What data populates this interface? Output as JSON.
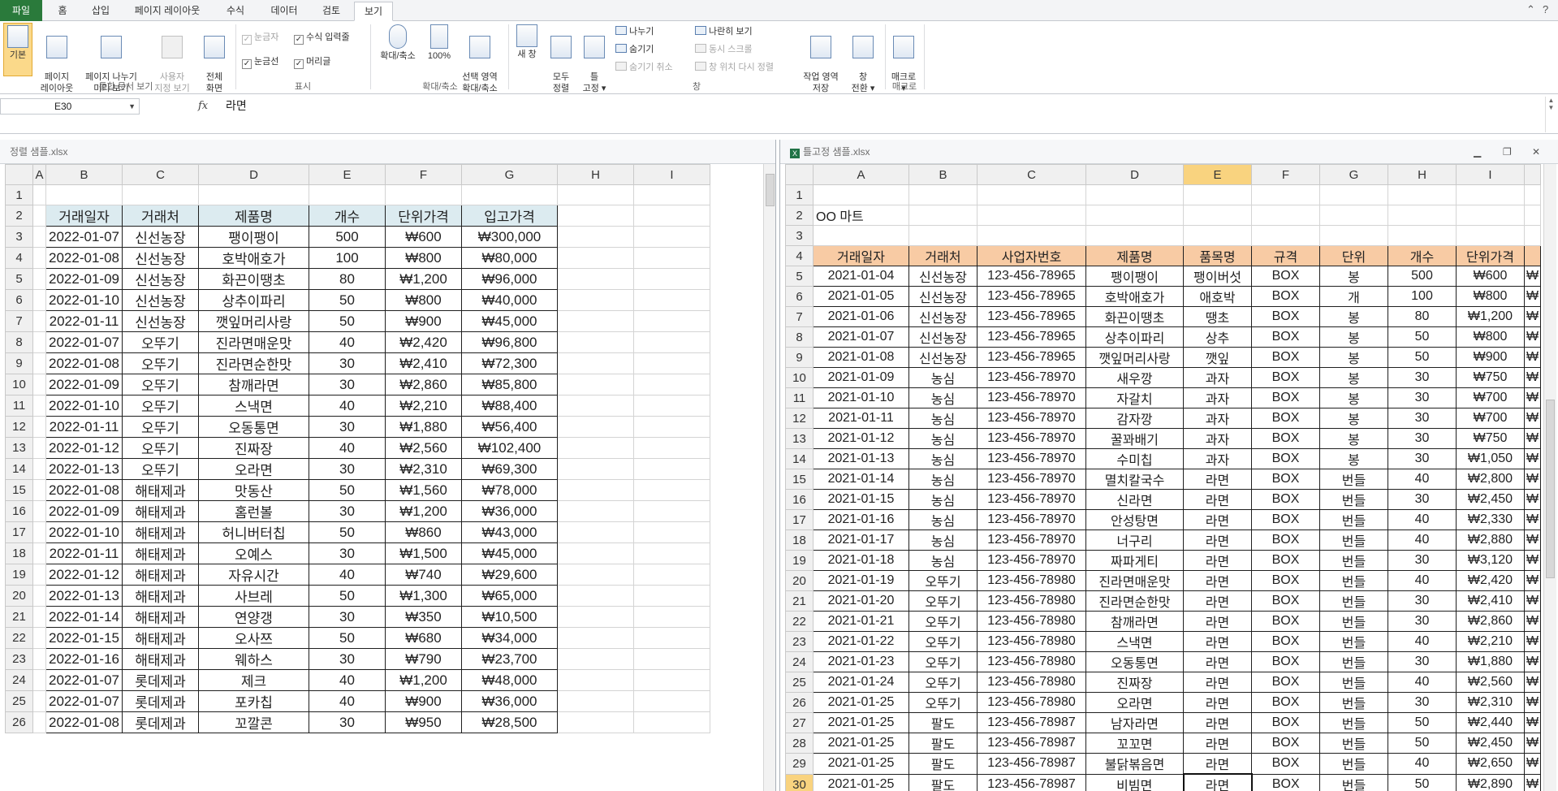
{
  "tabs": [
    "파일",
    "홈",
    "삽입",
    "페이지 레이아웃",
    "수식",
    "데이터",
    "검토",
    "보기"
  ],
  "ribbon": {
    "views": [
      "기본",
      "페이지\n레이아웃",
      "페이지 나누기\n미리 보기",
      "사용자\n지정 보기",
      "전체\n화면"
    ],
    "group_views": "통합 문서 보기",
    "show": [
      "눈금자",
      "수식 입력줄",
      "눈금선",
      "머리글"
    ],
    "group_show": "표시",
    "zoom": [
      "확대/축소",
      "100%",
      "선택 영역\n확대/축소"
    ],
    "group_zoom": "확대/축소",
    "window_big": [
      "새 창",
      "모두\n정렬",
      "틀\n고정 ▾"
    ],
    "window_small": [
      "나누기",
      "숨기기",
      "숨기기 취소",
      "나란히 보기",
      "동시 스크롤",
      "창 위치 다시 정렬"
    ],
    "window_big2": [
      "작업 영역\n저장",
      "창\n전환 ▾"
    ],
    "group_window": "창",
    "macro": "매크로\n▾",
    "group_macro": "매크로"
  },
  "formula": {
    "cell": "E30",
    "fx": "fx",
    "value": "라면"
  },
  "left": {
    "title": "정렬 샘플.xlsx",
    "cols": [
      "A",
      "B",
      "C",
      "D",
      "E",
      "F",
      "G",
      "H",
      "I"
    ],
    "headers": [
      "거래일자",
      "거래처",
      "제품명",
      "개수",
      "단위가격",
      "입고가격"
    ],
    "rows": [
      [
        "2022-01-07",
        "신선농장",
        "팽이팽이",
        "500",
        "₩600",
        "₩300,000"
      ],
      [
        "2022-01-08",
        "신선농장",
        "호박애호가",
        "100",
        "₩800",
        "₩80,000"
      ],
      [
        "2022-01-09",
        "신선농장",
        "화끈이땡초",
        "80",
        "₩1,200",
        "₩96,000"
      ],
      [
        "2022-01-10",
        "신선농장",
        "상추이파리",
        "50",
        "₩800",
        "₩40,000"
      ],
      [
        "2022-01-11",
        "신선농장",
        "깻잎머리사랑",
        "50",
        "₩900",
        "₩45,000"
      ],
      [
        "2022-01-07",
        "오뚜기",
        "진라면매운맛",
        "40",
        "₩2,420",
        "₩96,800"
      ],
      [
        "2022-01-08",
        "오뚜기",
        "진라면순한맛",
        "30",
        "₩2,410",
        "₩72,300"
      ],
      [
        "2022-01-09",
        "오뚜기",
        "참깨라면",
        "30",
        "₩2,860",
        "₩85,800"
      ],
      [
        "2022-01-10",
        "오뚜기",
        "스낵면",
        "40",
        "₩2,210",
        "₩88,400"
      ],
      [
        "2022-01-11",
        "오뚜기",
        "오동통면",
        "30",
        "₩1,880",
        "₩56,400"
      ],
      [
        "2022-01-12",
        "오뚜기",
        "진짜장",
        "40",
        "₩2,560",
        "₩102,400"
      ],
      [
        "2022-01-13",
        "오뚜기",
        "오라면",
        "30",
        "₩2,310",
        "₩69,300"
      ],
      [
        "2022-01-08",
        "해태제과",
        "맛동산",
        "50",
        "₩1,560",
        "₩78,000"
      ],
      [
        "2022-01-09",
        "해태제과",
        "홈런볼",
        "30",
        "₩1,200",
        "₩36,000"
      ],
      [
        "2022-01-10",
        "해태제과",
        "허니버터칩",
        "50",
        "₩860",
        "₩43,000"
      ],
      [
        "2022-01-11",
        "해태제과",
        "오예스",
        "30",
        "₩1,500",
        "₩45,000"
      ],
      [
        "2022-01-12",
        "해태제과",
        "자유시간",
        "40",
        "₩740",
        "₩29,600"
      ],
      [
        "2022-01-13",
        "해태제과",
        "사브레",
        "50",
        "₩1,300",
        "₩65,000"
      ],
      [
        "2022-01-14",
        "해태제과",
        "연양갱",
        "30",
        "₩350",
        "₩10,500"
      ],
      [
        "2022-01-15",
        "해태제과",
        "오사쯔",
        "50",
        "₩680",
        "₩34,000"
      ],
      [
        "2022-01-16",
        "해태제과",
        "웨하스",
        "30",
        "₩790",
        "₩23,700"
      ],
      [
        "2022-01-07",
        "롯데제과",
        "제크",
        "40",
        "₩1,200",
        "₩48,000"
      ],
      [
        "2022-01-07",
        "롯데제과",
        "포카칩",
        "40",
        "₩900",
        "₩36,000"
      ],
      [
        "2022-01-08",
        "롯데제과",
        "꼬깔콘",
        "30",
        "₩950",
        "₩28,500"
      ]
    ]
  },
  "right": {
    "title": "틀고정 샘플.xlsx",
    "cols": [
      "A",
      "B",
      "C",
      "D",
      "E",
      "F",
      "G",
      "H",
      "I",
      ""
    ],
    "store": "OO 마트",
    "headers": [
      "거래일자",
      "거래처",
      "사업자번호",
      "제품명",
      "품목명",
      "규격",
      "단위",
      "개수",
      "단위가격",
      ""
    ],
    "rows": [
      [
        "2021-01-04",
        "신선농장",
        "123-456-78965",
        "팽이팽이",
        "팽이버섯",
        "BOX",
        "봉",
        "500",
        "₩600",
        "₩"
      ],
      [
        "2021-01-05",
        "신선농장",
        "123-456-78965",
        "호박애호가",
        "애호박",
        "BOX",
        "개",
        "100",
        "₩800",
        "₩"
      ],
      [
        "2021-01-06",
        "신선농장",
        "123-456-78965",
        "화끈이땡초",
        "땡초",
        "BOX",
        "봉",
        "80",
        "₩1,200",
        "₩"
      ],
      [
        "2021-01-07",
        "신선농장",
        "123-456-78965",
        "상추이파리",
        "상추",
        "BOX",
        "봉",
        "50",
        "₩800",
        "₩"
      ],
      [
        "2021-01-08",
        "신선농장",
        "123-456-78965",
        "깻잎머리사랑",
        "깻잎",
        "BOX",
        "봉",
        "50",
        "₩900",
        "₩"
      ],
      [
        "2021-01-09",
        "농심",
        "123-456-78970",
        "새우깡",
        "과자",
        "BOX",
        "봉",
        "30",
        "₩750",
        "₩"
      ],
      [
        "2021-01-10",
        "농심",
        "123-456-78970",
        "자갈치",
        "과자",
        "BOX",
        "봉",
        "30",
        "₩700",
        "₩"
      ],
      [
        "2021-01-11",
        "농심",
        "123-456-78970",
        "감자깡",
        "과자",
        "BOX",
        "봉",
        "30",
        "₩700",
        "₩"
      ],
      [
        "2021-01-12",
        "농심",
        "123-456-78970",
        "꿀꽈배기",
        "과자",
        "BOX",
        "봉",
        "30",
        "₩750",
        "₩"
      ],
      [
        "2021-01-13",
        "농심",
        "123-456-78970",
        "수미칩",
        "과자",
        "BOX",
        "봉",
        "30",
        "₩1,050",
        "₩"
      ],
      [
        "2021-01-14",
        "농심",
        "123-456-78970",
        "멸치칼국수",
        "라면",
        "BOX",
        "번들",
        "40",
        "₩2,800",
        "₩"
      ],
      [
        "2021-01-15",
        "농심",
        "123-456-78970",
        "신라면",
        "라면",
        "BOX",
        "번들",
        "30",
        "₩2,450",
        "₩"
      ],
      [
        "2021-01-16",
        "농심",
        "123-456-78970",
        "안성탕면",
        "라면",
        "BOX",
        "번들",
        "40",
        "₩2,330",
        "₩"
      ],
      [
        "2021-01-17",
        "농심",
        "123-456-78970",
        "너구리",
        "라면",
        "BOX",
        "번들",
        "40",
        "₩2,880",
        "₩"
      ],
      [
        "2021-01-18",
        "농심",
        "123-456-78970",
        "짜파게티",
        "라면",
        "BOX",
        "번들",
        "30",
        "₩3,120",
        "₩"
      ],
      [
        "2021-01-19",
        "오뚜기",
        "123-456-78980",
        "진라면매운맛",
        "라면",
        "BOX",
        "번들",
        "40",
        "₩2,420",
        "₩"
      ],
      [
        "2021-01-20",
        "오뚜기",
        "123-456-78980",
        "진라면순한맛",
        "라면",
        "BOX",
        "번들",
        "30",
        "₩2,410",
        "₩"
      ],
      [
        "2021-01-21",
        "오뚜기",
        "123-456-78980",
        "참깨라면",
        "라면",
        "BOX",
        "번들",
        "30",
        "₩2,860",
        "₩"
      ],
      [
        "2021-01-22",
        "오뚜기",
        "123-456-78980",
        "스낵면",
        "라면",
        "BOX",
        "번들",
        "40",
        "₩2,210",
        "₩"
      ],
      [
        "2021-01-23",
        "오뚜기",
        "123-456-78980",
        "오동통면",
        "라면",
        "BOX",
        "번들",
        "30",
        "₩1,880",
        "₩"
      ],
      [
        "2021-01-24",
        "오뚜기",
        "123-456-78980",
        "진짜장",
        "라면",
        "BOX",
        "번들",
        "40",
        "₩2,560",
        "₩"
      ],
      [
        "2021-01-25",
        "오뚜기",
        "123-456-78980",
        "오라면",
        "라면",
        "BOX",
        "번들",
        "30",
        "₩2,310",
        "₩"
      ],
      [
        "2021-01-25",
        "팔도",
        "123-456-78987",
        "남자라면",
        "라면",
        "BOX",
        "번들",
        "50",
        "₩2,440",
        "₩"
      ],
      [
        "2021-01-25",
        "팔도",
        "123-456-78987",
        "꼬꼬면",
        "라면",
        "BOX",
        "번들",
        "50",
        "₩2,450",
        "₩"
      ],
      [
        "2021-01-25",
        "팔도",
        "123-456-78987",
        "불닭볶음면",
        "라면",
        "BOX",
        "번들",
        "40",
        "₩2,650",
        "₩"
      ],
      [
        "2021-01-25",
        "팔도",
        "123-456-78987",
        "비빔면",
        "라면",
        "BOX",
        "번들",
        "50",
        "₩2,890",
        "₩"
      ]
    ]
  }
}
